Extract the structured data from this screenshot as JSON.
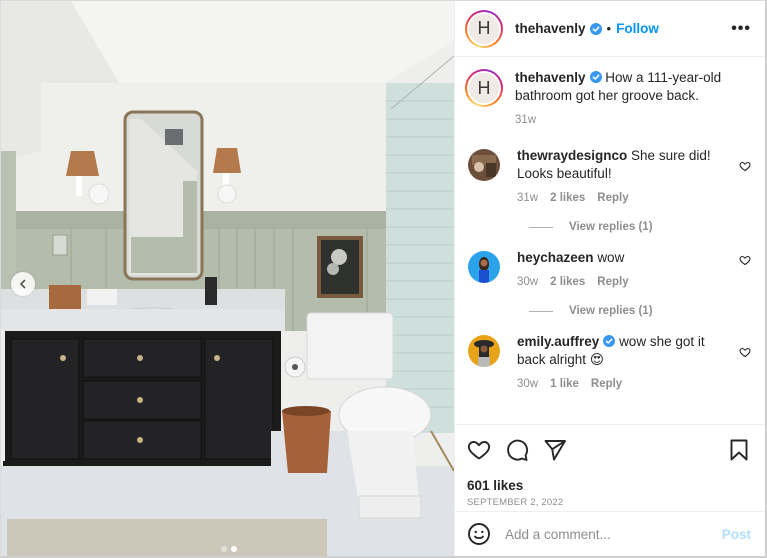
{
  "post": {
    "author": {
      "username": "thehavenly",
      "avatar_letter": "H",
      "verified": true,
      "follow_label": "Follow",
      "separator": "•",
      "more_label": "•••"
    },
    "caption": {
      "username": "thehavenly",
      "text": "How a 111-year-old bathroom got her groove back.",
      "age": "31w"
    },
    "comments": [
      {
        "username": "thewraydesignco",
        "verified": false,
        "text": "She sure did! Looks beautiful!",
        "age": "31w",
        "likes": "2 likes",
        "reply_label": "Reply",
        "view_replies": "View replies (1)",
        "avatar_color": "#6b4f3a"
      },
      {
        "username": "heychazeen",
        "verified": false,
        "text": "wow",
        "age": "30w",
        "likes": "2 likes",
        "reply_label": "Reply",
        "view_replies": "View replies (1)",
        "avatar_color": "#2a9fe8"
      },
      {
        "username": "emily.auffrey",
        "verified": true,
        "text": "wow she got it back alright",
        "emoji": "😍",
        "age": "30w",
        "likes": "1 like",
        "reply_label": "Reply",
        "avatar_color": "#e8a31a"
      }
    ],
    "likes": "601 likes",
    "date": "September 2, 2022",
    "add_comment": {
      "placeholder": "Add a comment...",
      "post_label": "Post"
    },
    "carousel": {
      "total": 2,
      "active_index": 1
    }
  },
  "colors": {
    "accent": "#0095f6",
    "verified": "#3897f0",
    "post_disabled": "#b2dffc",
    "muted": "#8e8e8e",
    "text": "#262626"
  },
  "icons": {
    "header_more": "more-horizontal-icon",
    "verified": "verified-badge-icon",
    "comment_like": "heart-outline-icon",
    "actions": [
      "heart-icon",
      "comment-icon",
      "share-icon",
      "bookmark-icon"
    ],
    "emoji": "emoji-smile-icon",
    "carousel_prev": "chevron-left-icon"
  }
}
